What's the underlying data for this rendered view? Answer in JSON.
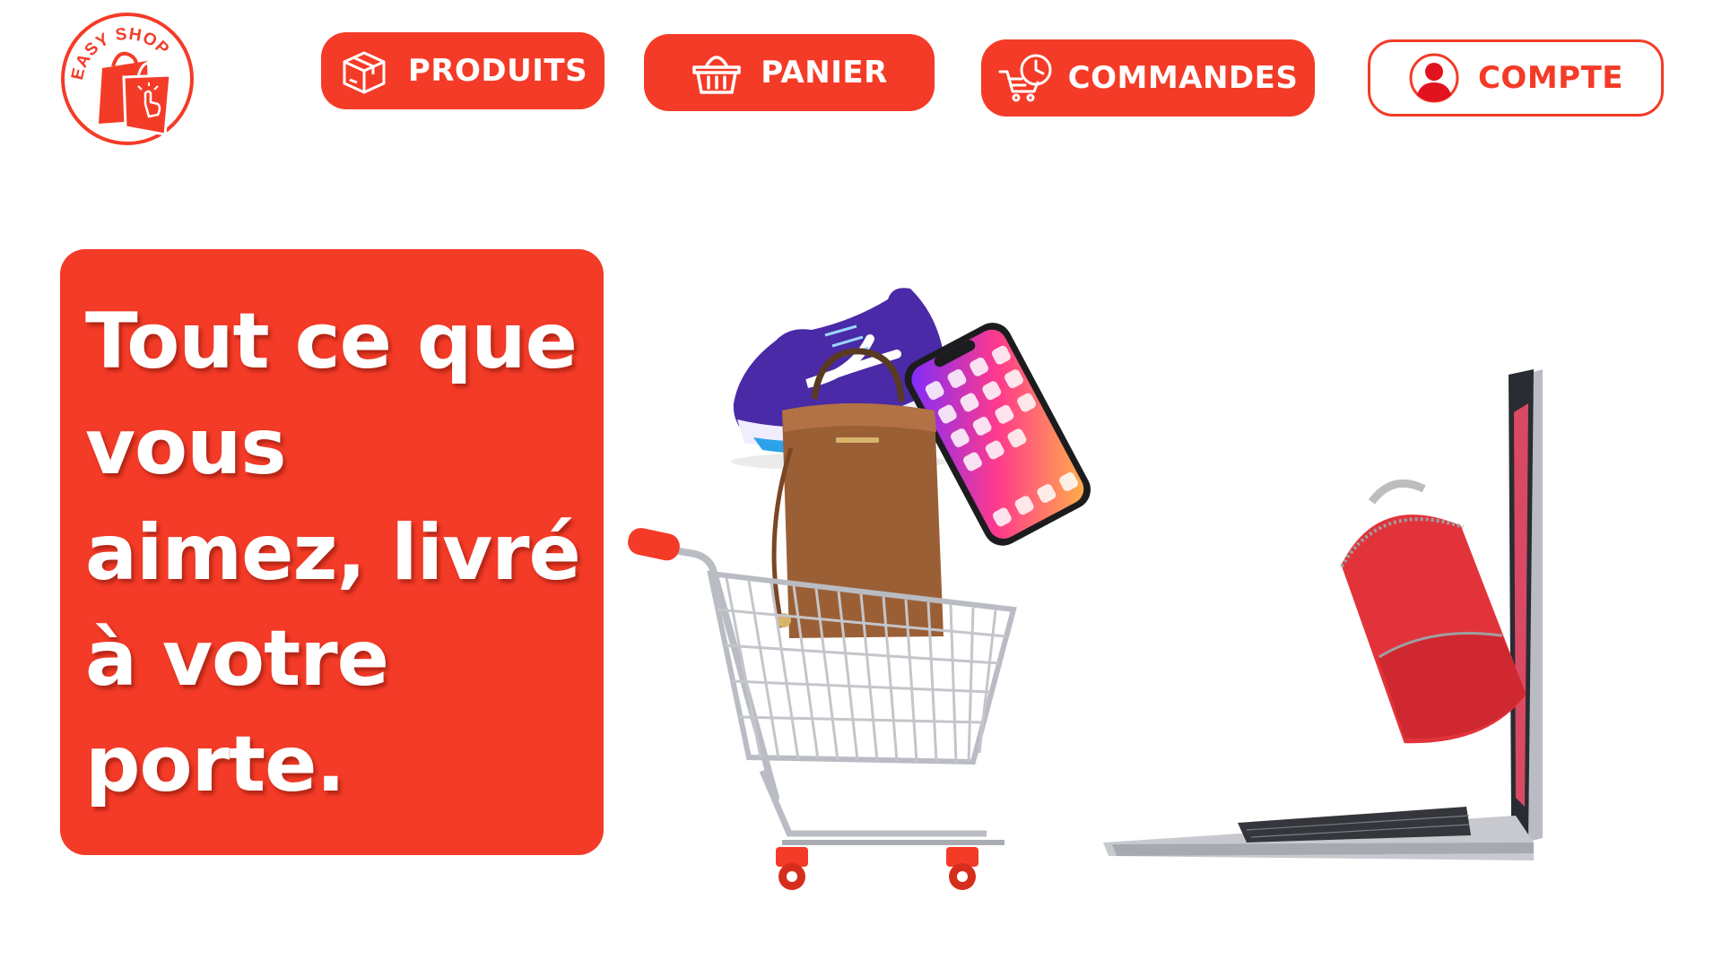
{
  "brand": {
    "logo_text": "EASY SHOP"
  },
  "nav": {
    "products_label": "PRODUITS",
    "cart_label": "PANIER",
    "orders_label": "COMMANDES",
    "account_label": "COMPTE",
    "icons": [
      "box-icon",
      "basket-icon",
      "cart-clock-icon",
      "user-icon"
    ]
  },
  "hero": {
    "lines": [
      "Tout ce que",
      "vous",
      "aimez, livré",
      "à votre",
      "porte."
    ]
  },
  "colors": {
    "accent": "#f43b27",
    "background": "#ffffff",
    "text_on_accent": "#ffffff"
  },
  "illustration": {
    "items": [
      "shopping-cart",
      "handbag",
      "sneaker",
      "smartphone",
      "backpack",
      "laptop"
    ]
  }
}
